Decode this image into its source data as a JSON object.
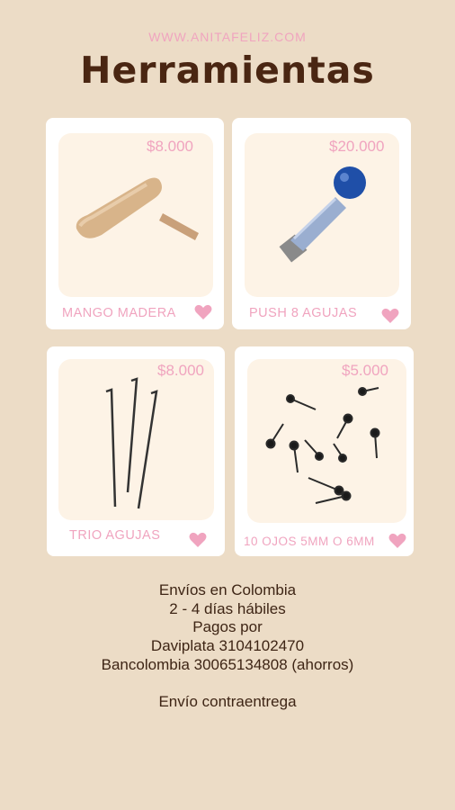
{
  "header": {
    "url": "WWW.ANITAFELIZ.COM",
    "title": "Herramientas"
  },
  "products": [
    {
      "name": "MANGO MADERA",
      "price": "$8.000",
      "icon": "wooden-handle"
    },
    {
      "name": "PUSH 8 AGUJAS",
      "price": "$20.000",
      "icon": "push-tool"
    },
    {
      "name": "TRIO AGUJAS",
      "price": "$8.000",
      "icon": "felting-needles"
    },
    {
      "name": "10 OJOS 5MM O 6MM",
      "price": "$5.000",
      "icon": "safety-eyes"
    }
  ],
  "info": {
    "line1": "Envíos en Colombia",
    "line2": "2 - 4 días hábiles",
    "line3": "Pagos por",
    "line4": "Daviplata 3104102470",
    "line5": "Bancolombia 30065134808 (ahorros)",
    "line6": "",
    "line7": "Envío contraentrega"
  },
  "colors": {
    "background": "#ecdcc6",
    "accent_pink": "#f0a4bf",
    "title_brown": "#4a2612"
  }
}
